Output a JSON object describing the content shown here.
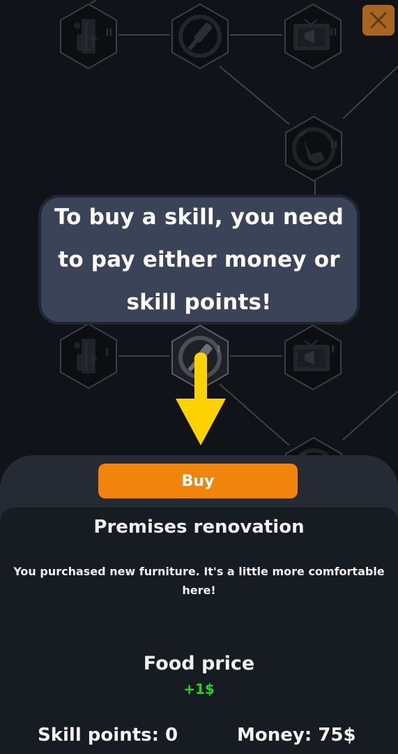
{
  "tooltip": {
    "text": "To buy a skill, you need to pay either money or skill points!"
  },
  "tree": {
    "nodes": [
      {
        "name": "skill-node-freezer-2",
        "icon": "freezer-upgrade-icon",
        "level": "II"
      },
      {
        "name": "skill-node-renovation-2",
        "icon": "paint-roller-icon",
        "level": ""
      },
      {
        "name": "skill-node-advertising-2",
        "icon": "tv-megaphone-icon",
        "level": "II"
      },
      {
        "name": "skill-node-service-2",
        "icon": "hand-tap-icon",
        "level": "II"
      },
      {
        "name": "skill-node-freezer-1",
        "icon": "freezer-upgrade-icon",
        "level": "I"
      },
      {
        "name": "skill-node-renovation-1",
        "icon": "paint-roller-icon",
        "level": "I"
      },
      {
        "name": "skill-node-advertising-1",
        "icon": "tv-megaphone-icon",
        "level": "I"
      },
      {
        "name": "skill-node-service-1",
        "icon": "hand-tap-icon",
        "level": "I"
      }
    ]
  },
  "close_icon": "close-icon",
  "panel": {
    "buy_label": "Buy",
    "title": "Premises renovation",
    "description": "You purchased new furniture. It's a little more comfortable here!",
    "stat_name": "Food price",
    "stat_value": "+1$",
    "skill_points": "Skill points: 0",
    "money": "Money: 75$"
  },
  "colors": {
    "background": "#101318",
    "tooltip": "#3a4357",
    "arrow": "#ffd200",
    "buy_button": "#f0840c",
    "close_button": "#a8651f",
    "stat_positive": "#22d61e"
  }
}
